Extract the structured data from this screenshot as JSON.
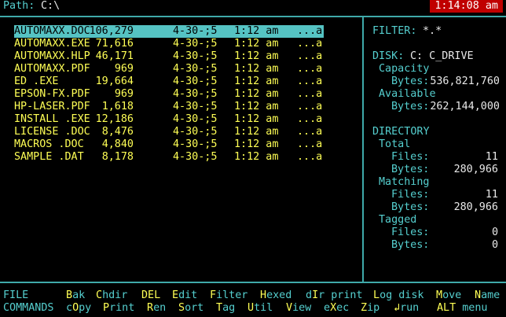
{
  "path": {
    "label": "Path:",
    "value": "C:\\"
  },
  "clock": "1:14:08 am",
  "files": [
    {
      "name": "AUTOMAXX.DOC",
      "size": "106,279",
      "date": "4-30-;5",
      "time": "1:12 am",
      "attr": "...a",
      "selected": true
    },
    {
      "name": "AUTOMAXX.EXE",
      "size": "71,616",
      "date": "4-30-;5",
      "time": "1:12 am",
      "attr": "...a"
    },
    {
      "name": "AUTOMAXX.HLP",
      "size": "46,171",
      "date": "4-30-;5",
      "time": "1:12 am",
      "attr": "...a"
    },
    {
      "name": "AUTOMAXX.PDF",
      "size": "969",
      "date": "4-30-;5",
      "time": "1:12 am",
      "attr": "...a"
    },
    {
      "name": "ED      .EXE",
      "size": "19,664",
      "date": "4-30-;5",
      "time": "1:12 am",
      "attr": "...a"
    },
    {
      "name": "EPSON-FX.PDF",
      "size": "969",
      "date": "4-30-;5",
      "time": "1:12 am",
      "attr": "...a"
    },
    {
      "name": "HP-LASER.PDF",
      "size": "1,618",
      "date": "4-30-;5",
      "time": "1:12 am",
      "attr": "...a"
    },
    {
      "name": "INSTALL .EXE",
      "size": "12,186",
      "date": "4-30-;5",
      "time": "1:12 am",
      "attr": "...a"
    },
    {
      "name": "LICENSE .DOC",
      "size": "8,476",
      "date": "4-30-;5",
      "time": "1:12 am",
      "attr": "...a"
    },
    {
      "name": "MACROS  .DOC",
      "size": "4,840",
      "date": "4-30-;5",
      "time": "1:12 am",
      "attr": "...a"
    },
    {
      "name": "SAMPLE  .DAT",
      "size": "8,178",
      "date": "4-30-;5",
      "time": "1:12 am",
      "attr": "...a"
    }
  ],
  "info": {
    "filter_label": "FILTER:",
    "filter_value": "*.*",
    "disk_label": "DISK:",
    "disk_value": "C: C_DRIVE",
    "capacity_label": "Capacity",
    "capacity_bytes_label": "Bytes:",
    "capacity_bytes": "536,821,760",
    "available_label": "Available",
    "available_bytes_label": "Bytes:",
    "available_bytes": "262,144,000",
    "directory_label": "DIRECTORY",
    "total_label": "Total",
    "total_files_label": "Files:",
    "total_files": "11",
    "total_bytes_label": "Bytes:",
    "total_bytes": "280,966",
    "matching_label": "Matching",
    "matching_files_label": "Files:",
    "matching_files": "11",
    "matching_bytes_label": "Bytes:",
    "matching_bytes": "280,966",
    "tagged_label": "Tagged",
    "tagged_files_label": "Files:",
    "tagged_files": "0",
    "tagged_bytes_label": "Bytes:",
    "tagged_bytes": "0"
  },
  "menu": {
    "file_label": "FILE",
    "commands_label": "COMMANDS",
    "row1": [
      {
        "key": "B",
        "rest": "ak"
      },
      {
        "key": "C",
        "rest": "hdir"
      },
      {
        "key": "DEL",
        "rest": ""
      },
      {
        "key": "E",
        "rest": "dit"
      },
      {
        "key": "F",
        "rest": "ilter"
      },
      {
        "key": "H",
        "rest": "exed"
      },
      {
        "pre": "d",
        "key": "I",
        "rest": "r print"
      },
      {
        "key": "L",
        "rest": "og disk"
      },
      {
        "key": "M",
        "rest": "ove"
      },
      {
        "key": "N",
        "rest": "ame"
      }
    ],
    "row2": [
      {
        "pre": "c",
        "key": "O",
        "rest": "py"
      },
      {
        "key": "P",
        "rest": "rint"
      },
      {
        "key": "R",
        "rest": "en"
      },
      {
        "key": "S",
        "rest": "ort"
      },
      {
        "key": "T",
        "rest": "ag"
      },
      {
        "key": "U",
        "rest": "til"
      },
      {
        "key": "V",
        "rest": "iew"
      },
      {
        "pre": "e",
        "key": "X",
        "rest": "ec"
      },
      {
        "key": "Z",
        "rest": "ip"
      },
      {
        "key": "↲",
        "rest": "run"
      },
      {
        "key": "ALT",
        "rest": " menu"
      }
    ]
  }
}
